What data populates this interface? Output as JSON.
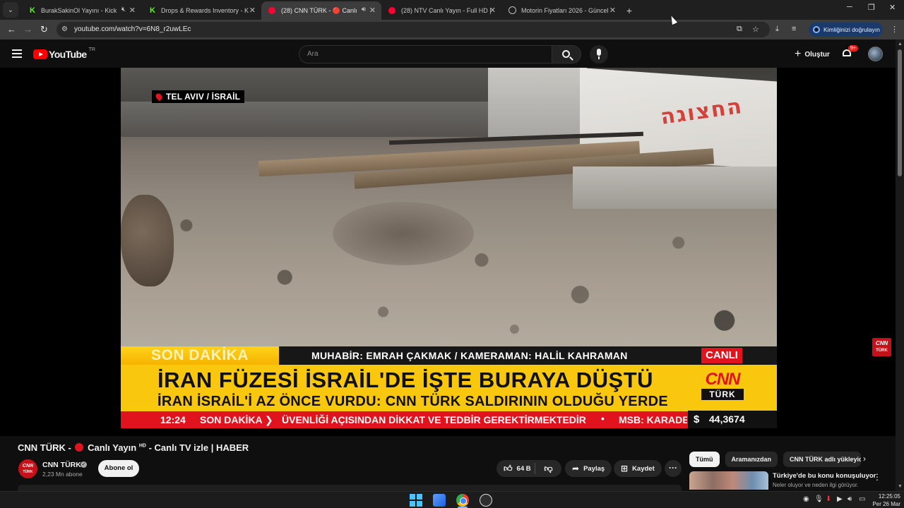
{
  "browser": {
    "tabs": [
      {
        "title": "BurakSakinOl Yayını - Kick",
        "favicon": "kick-icon",
        "extra_icon": "mute-icon",
        "active": false
      },
      {
        "title": "Drops & Rewards Inventory - K",
        "favicon": "kick-icon",
        "active": false
      },
      {
        "title": "(28) CNN TÜRK - 🔴 Canlı",
        "favicon": "youtube-icon",
        "extra_icon": "audio-icon",
        "active": true
      },
      {
        "title": "(28) NTV Canlı Yayın - Full HD |",
        "favicon": "youtube-icon",
        "active": false
      },
      {
        "title": "Motorin Fiyatları 2026 - Güncel",
        "favicon": "globe-icon",
        "active": false
      }
    ],
    "url": "youtube.com/watch?v=6N8_r2uwLEc",
    "profile_button": "Kimliğinizi doğrulayın"
  },
  "youtube": {
    "logo_text": "YouTube",
    "country_code": "TR",
    "search_placeholder": "Ara",
    "create_label": "Oluştur",
    "notification_count": "9+"
  },
  "video": {
    "location_tag": "TEL AVIV / İSRAİL",
    "sign_text": "החצוגה",
    "graphics": {
      "breaking_label": "SON DAKİKA",
      "crew_text": "MUHABİR: EMRAH ÇAKMAK / KAMERAMAN: HALİL KAHRAMAN",
      "live_label": "CANLI",
      "headline": "İRAN FÜZESİ İSRAİL'DE İŞTE BURAYA DÜŞTÜ",
      "subheadline": "İRAN İSRAİL'İ AZ ÖNCE VURDU: CNN TÜRK SALDIRININ OLDUĞU YERDE",
      "logo_top": "CNN",
      "logo_bottom": "TÜRK",
      "ticker_time": "12:24",
      "ticker_label": "SON DAKİKA ❯",
      "ticker_text": "ÜVENLİĞİ AÇISINDAN DİKKAT VE TEDBİR GEREKTİRMEKTEDİR",
      "ticker_bullet": "•",
      "ticker_next": "MSB: KARADE",
      "currency_symbol": "$",
      "currency_value": "44,3674"
    },
    "bug_top": "CNN",
    "bug_bottom": "TÜRK"
  },
  "watch": {
    "title_prefix": "CNN TÜRK -",
    "title_live": "Canlı Yayın",
    "title_hd": "HD",
    "title_suffix": "- Canlı TV izle | HABER",
    "channel_name": "CNN TÜRK",
    "channel_avatar_top": "CNN",
    "channel_avatar_bottom": "TÜRK",
    "subscribers": "2,23 Mn abone",
    "subscribe_label": "Abone ol",
    "like_count": "64 B",
    "share_label": "Paylaş",
    "save_label": "Kaydet"
  },
  "sidebar": {
    "chips": [
      "Tümü",
      "Aramanızdan",
      "CNN TÜRK adlı yükleyici"
    ],
    "recommendation": {
      "title": "Türkiye'de bu konu konuşuluyor",
      "subtitle": "Neler oluyor ve neden ilgi görüyor."
    }
  },
  "taskbar": {
    "time": "12:25:05",
    "date": "Per 26 Mar"
  }
}
